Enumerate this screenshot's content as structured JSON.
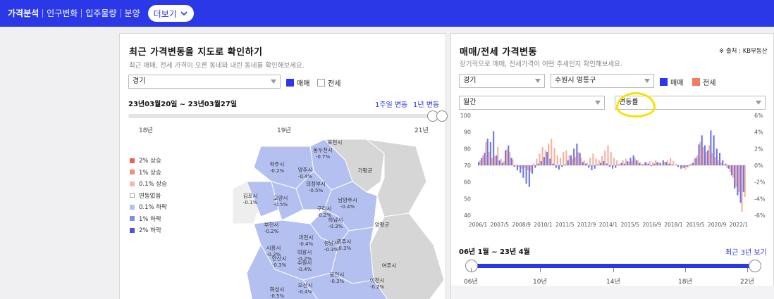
{
  "nav": {
    "items": [
      "가격분석",
      "인구변화",
      "입주물량",
      "분양"
    ],
    "more_label": "더보기"
  },
  "left": {
    "title": "최근 가격변동을 지도로 확인하기",
    "subtitle": "최근 매매, 전세 가격이 오른 동네와 내린 동네를 확인해보세요.",
    "region_select": "경기",
    "check_sale": "매매",
    "check_jeonse": "전세",
    "date_range": "23년03월20일 ~ 23년03월27일",
    "link_week": "1주일 변동",
    "link_year": "1년 변동",
    "ticks": [
      "18년",
      "19년",
      "21년"
    ],
    "legend": [
      {
        "label": "2% 상승",
        "color": "#e8605a"
      },
      {
        "label": "1% 상승",
        "color": "#f0907a"
      },
      {
        "label": "0.1% 상승",
        "color": "#f2b9a8"
      },
      {
        "label": "변동없음",
        "color": "#ffffff"
      },
      {
        "label": "0.1% 하락",
        "color": "#b4c0f0"
      },
      {
        "label": "1% 하락",
        "color": "#7a8fe8"
      },
      {
        "label": "2% 하락",
        "color": "#4a55d8"
      }
    ],
    "map_labels": [
      {
        "name": "포천시",
        "value": ""
      },
      {
        "name": "동두천시",
        "value": "-0.7%"
      },
      {
        "name": "파주시",
        "value": "-0.2%"
      },
      {
        "name": "양주시",
        "value": "-0.4%"
      },
      {
        "name": "가평군",
        "value": ""
      },
      {
        "name": "의정부시",
        "value": "-0.5%"
      },
      {
        "name": "김포시",
        "value": "-0.1%"
      },
      {
        "name": "고양시",
        "value": "-0.5%"
      },
      {
        "name": "남양주시",
        "value": "-0.4%"
      },
      {
        "name": "구리시",
        "value": "-0.2%"
      },
      {
        "name": "하남시",
        "value": "-0.3%"
      },
      {
        "name": "양평군",
        "value": ""
      },
      {
        "name": "부천시",
        "value": "-0.2%"
      },
      {
        "name": "과천시",
        "value": "-0.4%"
      },
      {
        "name": "시흥시",
        "value": "-0.2%"
      },
      {
        "name": "성남시",
        "value": "-0.3%"
      },
      {
        "name": "광주시",
        "value": "-0.3%"
      },
      {
        "name": "안산시",
        "value": "-0.3%"
      },
      {
        "name": "의왕시",
        "value": "-0.2%"
      },
      {
        "name": "수원시",
        "value": "-0.4%"
      },
      {
        "name": "여주시",
        "value": ""
      },
      {
        "name": "용인시",
        "value": "-0.3%"
      },
      {
        "name": "이천시",
        "value": "-0.2%"
      },
      {
        "name": "화성시",
        "value": "-0.5%"
      },
      {
        "name": "오산시",
        "value": "-0.4%"
      }
    ]
  },
  "right": {
    "title": "매매/전세 가격변동",
    "source": "※ 출처 : KB부동산",
    "subtitle": "장기적으로 매매, 전세가격이 어떤 추세인지 확인해보세요.",
    "region_select": "경기",
    "district_select": "수원시 영통구",
    "check_sale": "매매",
    "check_jeonse": "전세",
    "period_select": "월간",
    "metric_select": "변동률",
    "date_range": "06년 1월 ~ 23년 4월",
    "recent_link": "최근 3년 보기",
    "slider_ticks": [
      "06년",
      "10년",
      "14년",
      "18년",
      "22년"
    ],
    "colors": {
      "sale": "#3a48e8",
      "jeonse": "#f37c5e"
    }
  },
  "chart_data": {
    "type": "bar",
    "x_ticks": [
      "2006/1",
      "2007/5",
      "2008/9",
      "2010/1",
      "2011/5",
      "2012/9",
      "2014/1",
      "2015/5",
      "2016/9",
      "2018/1",
      "2019/5",
      "2020/9",
      "2022/1"
    ],
    "y_left_ticks": [
      100,
      90,
      80,
      70,
      60,
      50,
      40
    ],
    "y_right_ticks": [
      "6%",
      "4%",
      "2%",
      "0%",
      "-2%",
      "-4%",
      "-6%"
    ],
    "ylim_right": [
      -6,
      6
    ],
    "series": [
      {
        "name": "매매",
        "values": [
          0.4,
          0.9,
          1.5,
          3.2,
          2.8,
          4.1,
          1.2,
          0.6,
          0.3,
          1.8,
          2.4,
          0.9,
          -0.2,
          -0.6,
          -0.9,
          -1.5,
          -2.2,
          -2.6,
          -1.0,
          -0.3,
          0.2,
          0.5,
          1.0,
          1.6,
          0.8,
          0.2,
          -0.3,
          -0.5,
          -0.2,
          0.1,
          0.6,
          1.2,
          2.0,
          2.6,
          1.5,
          0.4,
          0.2,
          -0.3,
          -0.6,
          -0.4,
          0.1,
          0.3,
          0.5,
          0.2,
          -0.2,
          -0.4,
          -0.3,
          0.1,
          0.3,
          0.2,
          0.5,
          0.9,
          1.2,
          0.6,
          0.3,
          0.1,
          0.4,
          0.2,
          -0.1,
          0.2,
          0.4,
          0.3,
          0.6,
          0.4,
          0.2,
          0.1,
          0.0,
          -0.2,
          -0.4,
          -0.3,
          -0.2,
          0.1,
          0.3,
          0.9,
          2.5,
          3.6,
          2.4,
          1.8,
          4.2,
          3.6,
          2.0,
          1.5,
          0.6,
          0.2,
          -0.4,
          -1.2,
          -2.8,
          -3.6,
          -4.5,
          -3.2
        ]
      },
      {
        "name": "전세",
        "values": [
          0.6,
          1.2,
          2.8,
          1.6,
          0.9,
          1.1,
          2.2,
          0.8,
          0.5,
          1.9,
          1.6,
          0.7,
          0.1,
          -0.2,
          -0.4,
          -0.3,
          -0.6,
          -0.8,
          0.2,
          0.8,
          1.4,
          2.2,
          1.8,
          2.6,
          3.2,
          2.1,
          1.2,
          0.9,
          1.6,
          1.8,
          1.2,
          0.8,
          1.0,
          1.6,
          0.9,
          0.6,
          0.3,
          0.9,
          1.4,
          0.8,
          0.6,
          1.1,
          1.8,
          2.4,
          1.6,
          0.9,
          0.6,
          0.2,
          0.6,
          0.8,
          0.4,
          0.5,
          0.9,
          0.6,
          0.3,
          0.2,
          0.3,
          0.5,
          0.4,
          0.6,
          0.3,
          0.1,
          0.4,
          0.6,
          0.9,
          0.5,
          0.2,
          0.0,
          -0.3,
          -0.5,
          -0.2,
          0.2,
          0.8,
          1.2,
          2.8,
          2.2,
          1.6,
          2.4,
          1.5,
          1.0,
          0.6,
          0.3,
          0.1,
          -0.3,
          -0.8,
          -1.5,
          -2.6,
          -3.2,
          -5.6,
          -3.8
        ]
      }
    ]
  }
}
